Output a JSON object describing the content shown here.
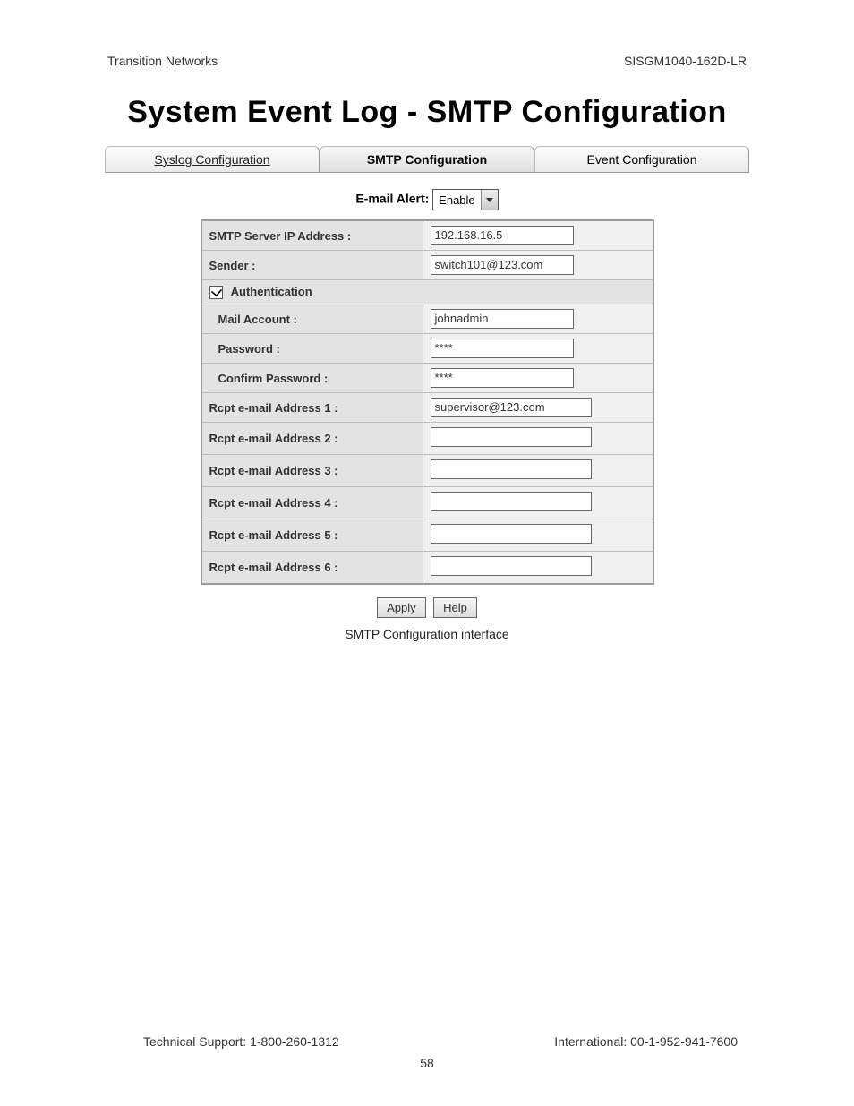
{
  "header": {
    "left": "Transition Networks",
    "right": "SISGM1040-162D-LR"
  },
  "title": "System Event Log - SMTP Configuration",
  "tabs": {
    "syslog": "Syslog Configuration",
    "smtp": "SMTP Configuration",
    "event": "Event Configuration"
  },
  "email_alert": {
    "label": "E-mail Alert:",
    "value": "Enable"
  },
  "form": {
    "smtp_ip_label": "SMTP Server IP Address :",
    "smtp_ip_value": "192.168.16.5",
    "sender_label": "Sender :",
    "sender_value": "switch101@123.com",
    "auth_label": "Authentication",
    "auth_checked": true,
    "mail_account_label": "Mail Account :",
    "mail_account_value": "johnadmin",
    "password_label": "Password :",
    "password_value": "****",
    "confirm_password_label": "Confirm Password :",
    "confirm_password_value": "****",
    "rcpt1_label": "Rcpt e-mail Address 1 :",
    "rcpt1_value": "supervisor@123.com",
    "rcpt2_label": "Rcpt e-mail Address 2 :",
    "rcpt2_value": "",
    "rcpt3_label": "Rcpt e-mail Address 3 :",
    "rcpt3_value": "",
    "rcpt4_label": "Rcpt e-mail Address 4 :",
    "rcpt4_value": "",
    "rcpt5_label": "Rcpt e-mail Address 5 :",
    "rcpt5_value": "",
    "rcpt6_label": "Rcpt e-mail Address 6 :",
    "rcpt6_value": ""
  },
  "buttons": {
    "apply": "Apply",
    "help": "Help"
  },
  "caption": "SMTP Configuration interface",
  "footer": {
    "tech": "Technical Support: 1-800-260-1312",
    "intl": "International: 00-1-952-941-7600",
    "page": "58"
  }
}
